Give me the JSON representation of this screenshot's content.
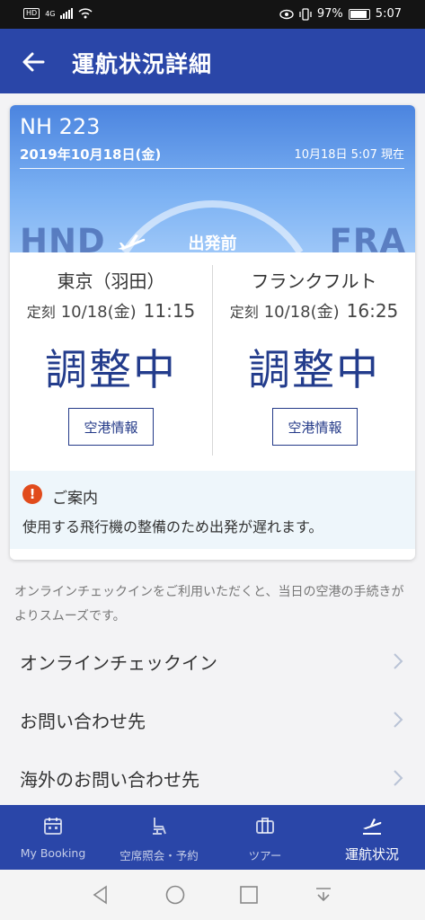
{
  "status_bar": {
    "hd": "HD",
    "network": "4G",
    "battery": "97%",
    "time": "5:07",
    "icons": [
      "signal-icon",
      "wifi-icon",
      "eye-icon",
      "vibrate-icon",
      "battery-icon"
    ]
  },
  "header": {
    "title": "運航状況詳細",
    "back_icon": "back-arrow-icon"
  },
  "flight": {
    "number": "NH 223",
    "date": "2019年10月18日(金)",
    "as_of": "10月18日 5:07 現在",
    "status": "出発前",
    "from_code": "HND",
    "to_code": "FRA",
    "departure": {
      "city": "東京（羽田）",
      "label": "定刻",
      "date": "10/18(金)",
      "time": "11:15",
      "state": "調整中",
      "button": "空港情報"
    },
    "arrival": {
      "city": "フランクフルト",
      "label": "定刻",
      "date": "10/18(金)",
      "time": "16:25",
      "state": "調整中",
      "button": "空港情報"
    },
    "notice": {
      "icon_text": "!",
      "title": "ご案内",
      "body": "使用する飛行機の整備のため出発が遅れます。"
    }
  },
  "info_text": "オンラインチェックインをご利用いただくと、当日の空港の手続きがよりスムーズです。",
  "menu": [
    {
      "label": "オンラインチェックイン"
    },
    {
      "label": "お問い合わせ先"
    },
    {
      "label": "海外のお問い合わせ先"
    }
  ],
  "bottom_nav": [
    {
      "label": "My Booking",
      "icon": "calendar-icon"
    },
    {
      "label": "空席照会・予約",
      "icon": "seat-icon"
    },
    {
      "label": "ツアー",
      "icon": "suitcase-icon"
    },
    {
      "label": "運航状況",
      "icon": "departure-icon",
      "active": true
    }
  ],
  "colors": {
    "primary": "#2a46a8",
    "accent_text": "#233c8c",
    "notice_bg": "#eef6fb",
    "alert": "#e14b1c"
  }
}
